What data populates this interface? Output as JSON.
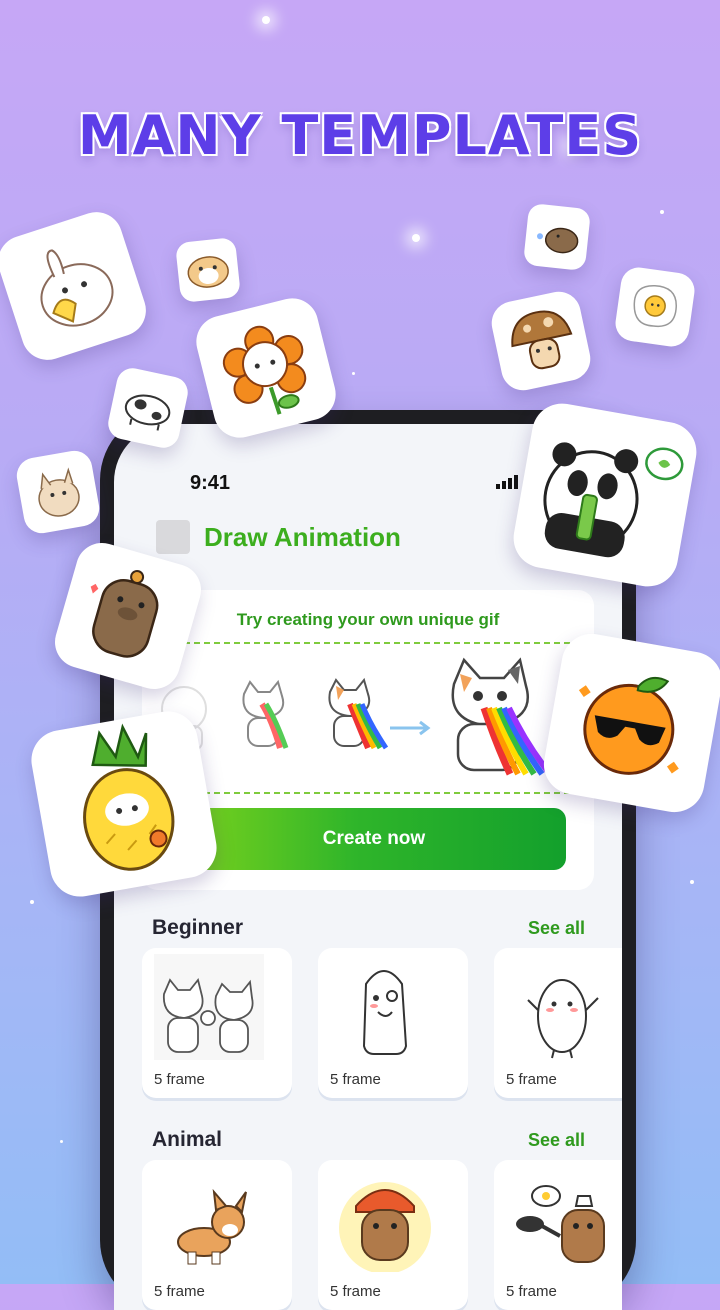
{
  "headline": "MANY TEMPLATES",
  "status_bar": {
    "time": "9:41"
  },
  "app": {
    "title": "Draw Animation"
  },
  "promo": {
    "title": "Try creating your own unique gif",
    "button_label": "Create now"
  },
  "sections": [
    {
      "title": "Beginner",
      "see_all": "See all",
      "items": [
        {
          "frames": "5 frame",
          "icon": "cats-fist-bump"
        },
        {
          "frames": "5 frame",
          "icon": "egg-character"
        },
        {
          "frames": "5 frame",
          "icon": "potato-waving"
        }
      ]
    },
    {
      "title": "Animal",
      "see_all": "See all",
      "items": [
        {
          "frames": "5 frame",
          "icon": "corgi"
        },
        {
          "frames": "5 frame",
          "icon": "capybara-chief"
        },
        {
          "frames": "5 frame",
          "icon": "capybara-chef"
        }
      ]
    }
  ],
  "stickers": [
    "bunny-banana-sticker",
    "hamster-sticker",
    "flower-cat-sticker",
    "cow-sticker",
    "puppy-sticker",
    "capybara-sticker",
    "pineapple-sticker",
    "capybara-bird-sticker",
    "fried-egg-sticker",
    "mushroom-sticker",
    "panda-sticker",
    "orange-sunglasses-sticker"
  ],
  "colors": {
    "accent": "#3cae1e",
    "headline": "#5d3ee8",
    "button": "#13a02c"
  }
}
